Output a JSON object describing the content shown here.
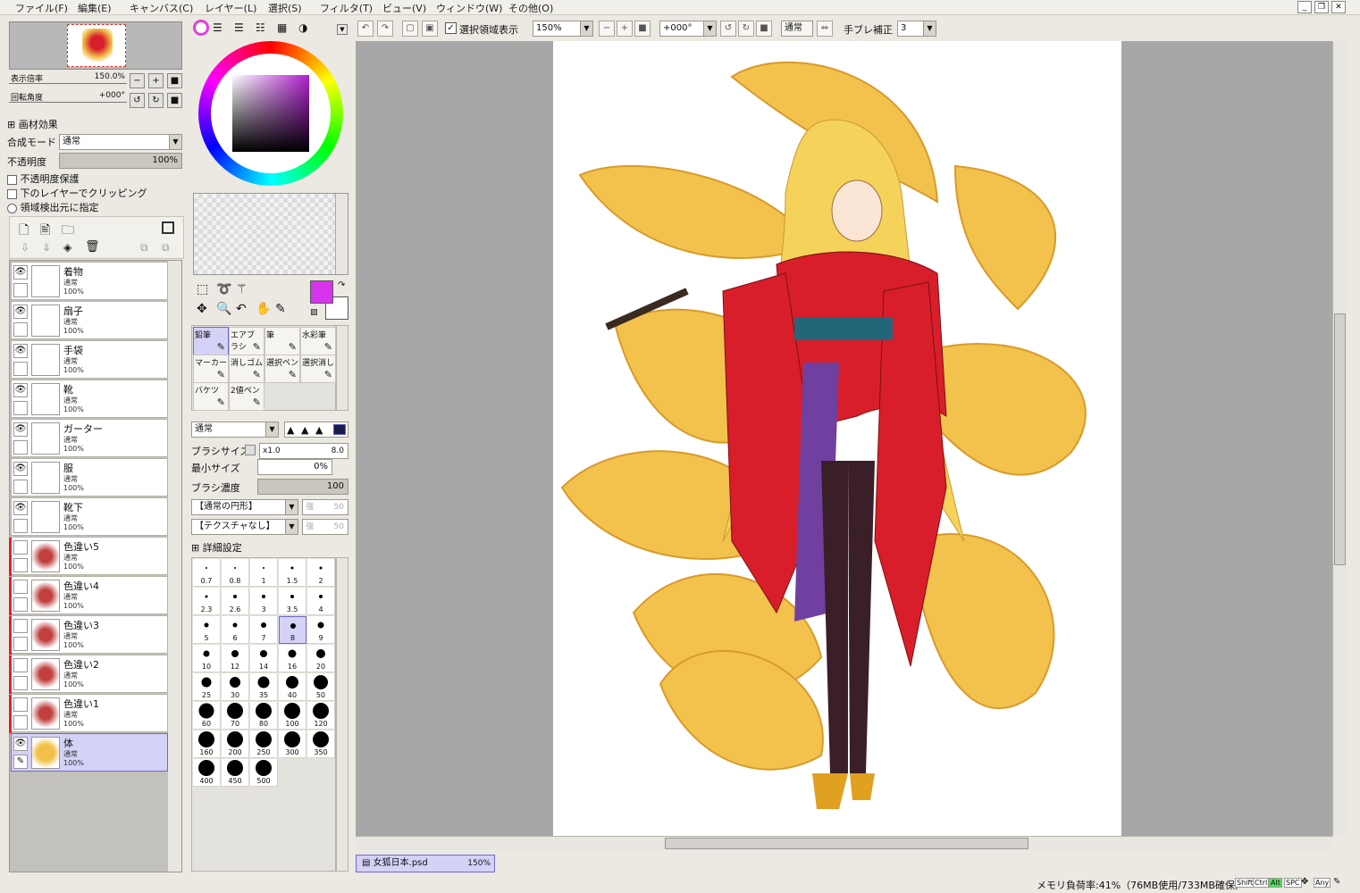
{
  "menu": [
    "ファイル(F)",
    "編集(E)",
    "キャンバス(C)",
    "レイヤー(L)",
    "選択(S)",
    "フィルタ(T)",
    "ビュー(V)",
    "ウィンドウ(W)",
    "その他(O)"
  ],
  "toolbar": {
    "selection_display_label": "選択領域表示",
    "zoom_value": "150%",
    "rotation_value": "+000°",
    "blend_mode": "通常",
    "stabilizer_label": "手ブレ補正",
    "stabilizer_value": "3"
  },
  "navigator": {
    "zoom_label": "表示倍率",
    "zoom_value": "150.0%",
    "angle_label": "回転角度",
    "angle_value": "+000°"
  },
  "layer_props": {
    "effect_label": "画材効果",
    "blend_label": "合成モード",
    "blend_value": "通常",
    "opacity_label": "不透明度",
    "opacity_value": "100%",
    "opt1": "不透明度保護",
    "opt2": "下のレイヤーでクリッピング",
    "opt3": "領域検出元に指定"
  },
  "layers": [
    {
      "name": "着物",
      "mode": "通常",
      "opacity": "100%"
    },
    {
      "name": "扇子",
      "mode": "通常",
      "opacity": "100%"
    },
    {
      "name": "手袋",
      "mode": "通常",
      "opacity": "100%"
    },
    {
      "name": "靴",
      "mode": "通常",
      "opacity": "100%"
    },
    {
      "name": "ガーター",
      "mode": "通常",
      "opacity": "100%"
    },
    {
      "name": "服",
      "mode": "通常",
      "opacity": "100%"
    },
    {
      "name": "靴下",
      "mode": "通常",
      "opacity": "100%"
    },
    {
      "name": "色違い5",
      "mode": "通常",
      "opacity": "100%"
    },
    {
      "name": "色違い4",
      "mode": "通常",
      "opacity": "100%"
    },
    {
      "name": "色違い3",
      "mode": "通常",
      "opacity": "100%"
    },
    {
      "name": "色違い2",
      "mode": "通常",
      "opacity": "100%"
    },
    {
      "name": "色違い1",
      "mode": "通常",
      "opacity": "100%"
    },
    {
      "name": "体",
      "mode": "通常",
      "opacity": "100%"
    }
  ],
  "tools": [
    {
      "label": "鉛筆"
    },
    {
      "label": "エアブラシ"
    },
    {
      "label": "筆"
    },
    {
      "label": "水彩筆"
    },
    {
      "label": "マーカー"
    },
    {
      "label": "消しゴム"
    },
    {
      "label": "選択ペン"
    },
    {
      "label": "選択消し"
    },
    {
      "label": "バケツ"
    },
    {
      "label": "2値ペン"
    }
  ],
  "brush": {
    "mode": "通常",
    "size_label": "ブラシサイズ",
    "size_mult": "x1.0",
    "size_value": "8.0",
    "min_label": "最小サイズ",
    "min_value": "0%",
    "density_label": "ブラシ濃度",
    "density_value": "100",
    "shape": "【通常の円形】",
    "texture": "【テクスチャなし】",
    "shape_val": "強",
    "shape_num": "50",
    "tex_val": "強",
    "tex_num": "50",
    "detail_label": "詳細設定"
  },
  "brush_sizes": [
    "0.7",
    "0.8",
    "1",
    "1.5",
    "2",
    "2.3",
    "2.6",
    "3",
    "3.5",
    "4",
    "5",
    "6",
    "7",
    "8",
    "9",
    "10",
    "12",
    "14",
    "16",
    "20",
    "25",
    "30",
    "35",
    "40",
    "50",
    "60",
    "70",
    "80",
    "100",
    "120",
    "160",
    "200",
    "250",
    "300",
    "350",
    "400",
    "450",
    "500"
  ],
  "document_tab": {
    "name": "女狐日本.psd",
    "zoom": "150%"
  },
  "status": {
    "memory": "メモリ負荷率:41%（76MB使用/733MB確保）",
    "keys": [
      "Shift",
      "Ctrl",
      "Alt",
      "SPC",
      "Any"
    ]
  },
  "colors": {
    "accent": "#d4d2f7",
    "primary_color": "#d634ea",
    "tail": "#f0c04a",
    "kimono": "#d81e2a"
  }
}
